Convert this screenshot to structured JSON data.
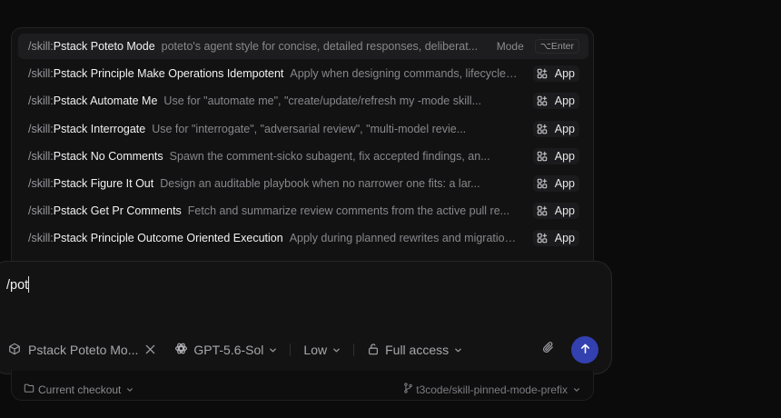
{
  "suggestions": {
    "items": [
      {
        "prefix": "/skill:",
        "name": "Pstack Poteto Mode",
        "desc": "poteto's agent style for concise, detailed responses, deliberat...",
        "kind": "mode",
        "mode_label": "Mode",
        "shortcut": "⌥Enter"
      },
      {
        "prefix": "/skill:",
        "name": "Pstack Principle Make Operations Idempotent",
        "desc": "Apply when designing commands, lifecycle steps, or pr...",
        "kind": "app",
        "badge": "App"
      },
      {
        "prefix": "/skill:",
        "name": "Pstack Automate Me",
        "desc": "Use for \"automate me\", \"create/update/refresh my -mode skill...",
        "kind": "app",
        "badge": "App"
      },
      {
        "prefix": "/skill:",
        "name": "Pstack Interrogate",
        "desc": "Use for \"interrogate\", \"adversarial review\", \"multi-model revie...",
        "kind": "app",
        "badge": "App"
      },
      {
        "prefix": "/skill:",
        "name": "Pstack No Comments",
        "desc": "Spawn the comment-sicko subagent, fix accepted findings, an...",
        "kind": "app",
        "badge": "App"
      },
      {
        "prefix": "/skill:",
        "name": "Pstack Figure It Out",
        "desc": "Design an auditable playbook when no narrower one fits: a lar...",
        "kind": "app",
        "badge": "App"
      },
      {
        "prefix": "/skill:",
        "name": "Pstack Get Pr Comments",
        "desc": "Fetch and summarize review comments from the active pull re...",
        "kind": "app",
        "badge": "App"
      },
      {
        "prefix": "/skill:",
        "name": "Pstack Principle Outcome Oriented Execution",
        "desc": "Apply during planned rewrites and migrations with expli...",
        "kind": "app",
        "badge": "App"
      }
    ]
  },
  "composer": {
    "input_value": "/pot",
    "skill_chip": "Pstack Poteto Mo...",
    "model": "GPT-5.6-Sol",
    "reasoning": "Low",
    "access": "Full access"
  },
  "footer": {
    "checkout": "Current checkout",
    "branch": "t3code/skill-pinned-mode-prefix"
  },
  "icons": {
    "app_badge": "grid-plus-icon",
    "skill": "cube-icon",
    "model": "openai-icon",
    "access": "unlock-icon",
    "attach": "paperclip-icon",
    "send": "arrow-up-icon",
    "folder": "folder-icon",
    "branch": "git-branch-icon"
  },
  "colors": {
    "send_button": "#3340b0",
    "background": "#0b0b0c"
  }
}
